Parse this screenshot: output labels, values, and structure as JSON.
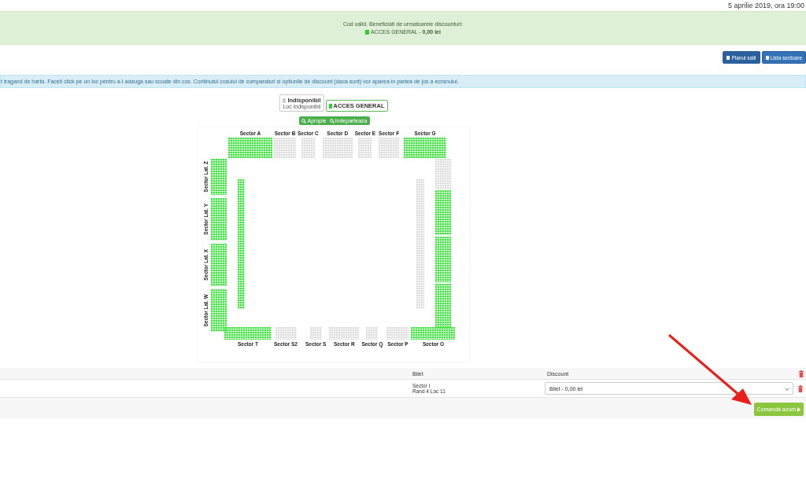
{
  "header": {
    "event_date": "5 aprilie 2019, ora 19:00"
  },
  "discount_banner": {
    "message": "Cod valid. Beneficiati de urmatoarele discounturi:",
    "discount_name": "ACCES GENERAL",
    "separator": "-",
    "discount_value": "0,00 lei"
  },
  "view_buttons": [
    {
      "label": "Planul salii",
      "selected": true
    },
    {
      "label": "Lista sectoare",
      "selected": false
    }
  ],
  "info_text": "t tragand de harta. Faceti click pe un loc pentru a-l adauga sau scoate din cos. Continutul cosului de cumparaturi si optiunile de discount (daca sunt) vor aparea in partea de jos a ecranului.",
  "legend": [
    {
      "title": "Indisponibil",
      "subtitle": "Loc indisponibil",
      "available": false,
      "selected": false
    },
    {
      "title": "ACCES GENERAL",
      "available": true,
      "selected": true
    }
  ],
  "zoom_buttons": [
    {
      "label": "Apropie"
    },
    {
      "label": "Indeparteaza"
    }
  ],
  "seat_map": {
    "top_sectors": [
      {
        "label": "Sector A",
        "available": true
      },
      {
        "label": "Sector B",
        "available": false
      },
      {
        "label": "Sector C",
        "available": false
      },
      {
        "label": "Sector D",
        "available": false
      },
      {
        "label": "Sector E",
        "available": false
      },
      {
        "label": "Sector F",
        "available": false
      },
      {
        "label": "Sector G",
        "available": true
      }
    ],
    "bottom_sectors": [
      {
        "label": "Sector T",
        "available": true
      },
      {
        "label": "Sector S2",
        "available": false
      },
      {
        "label": "Sector S",
        "available": false
      },
      {
        "label": "Sector R",
        "available": false
      },
      {
        "label": "Sector Q",
        "available": false
      },
      {
        "label": "Sector P",
        "available": false
      },
      {
        "label": "Sector O",
        "available": true
      }
    ],
    "left_sectors": [
      {
        "label": "Sector Lat. Z",
        "available": true
      },
      {
        "label": "Sector Lat. Y",
        "available": true
      },
      {
        "label": "Sector Lat. X",
        "available": true
      },
      {
        "label": "Sector Lat. W",
        "available": true
      }
    ],
    "inner_left": {
      "available": true
    },
    "inner_right": {
      "available": false
    },
    "right_sectors": [
      {
        "available": false
      },
      {
        "available": true
      },
      {
        "available": true
      },
      {
        "available": true
      }
    ]
  },
  "cart": {
    "columns": [
      "Bilet",
      "Discount"
    ],
    "rows": [
      {
        "sector": "Sector I",
        "seat": "Rand 4 Loc 11",
        "discount": "Bilet - 0,00 lei"
      }
    ]
  },
  "order_button": {
    "label": "Comanda acum"
  }
}
